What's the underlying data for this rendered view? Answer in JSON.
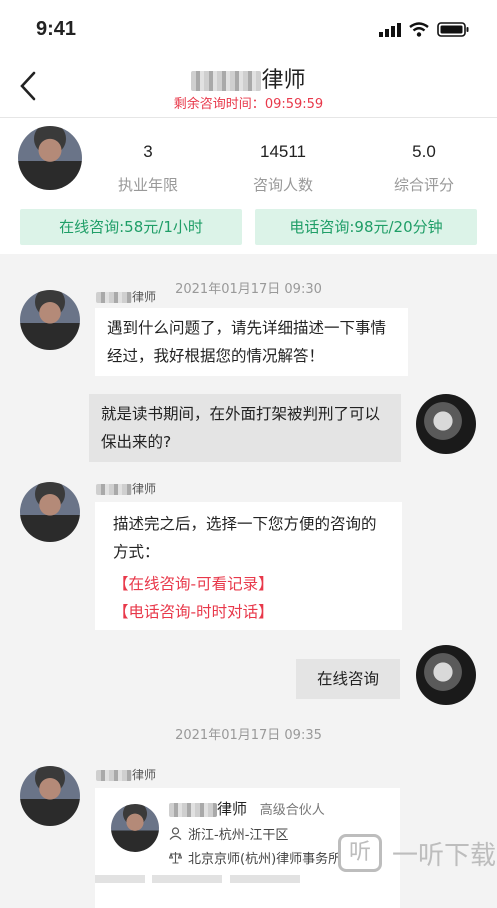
{
  "status_bar": {
    "time": "9:41"
  },
  "header": {
    "title_suffix": "律师",
    "timer_label": "剩余咨询时间：",
    "timer_value": "09:59:59"
  },
  "profile": {
    "stats": [
      {
        "value": "3",
        "label": "执业年限"
      },
      {
        "value": "14511",
        "label": "咨询人数"
      },
      {
        "value": "5.0",
        "label": "综合评分"
      }
    ],
    "online_price": "在线咨询:58元/1小时",
    "phone_price": "电话咨询:98元/20分钟"
  },
  "chat": {
    "timestamp_1": "2021年01月17日 09:30",
    "timestamp_2": "2021年01月17日 09:35",
    "lawyer_name_suffix": "律师",
    "msg1": "遇到什么问题了，请先详细描述一下事情经过，我好根据您的情况解答！",
    "msg2": "就是读书期间，在外面打架被判刑了可以保出来的?",
    "msg3": "描述完之后，选择一下您方便的咨询的方式：",
    "option_online": "【在线咨询-可看记录】",
    "option_phone": "【电话咨询-时时对话】",
    "msg4": "在线咨询",
    "card": {
      "name_suffix": "律师",
      "rank": "高级合伙人",
      "location": "浙江-杭州-江干区",
      "firm": "北京京师(杭州)律师事务所"
    }
  },
  "watermark": {
    "glyph": "听",
    "text": "一听下载"
  }
}
